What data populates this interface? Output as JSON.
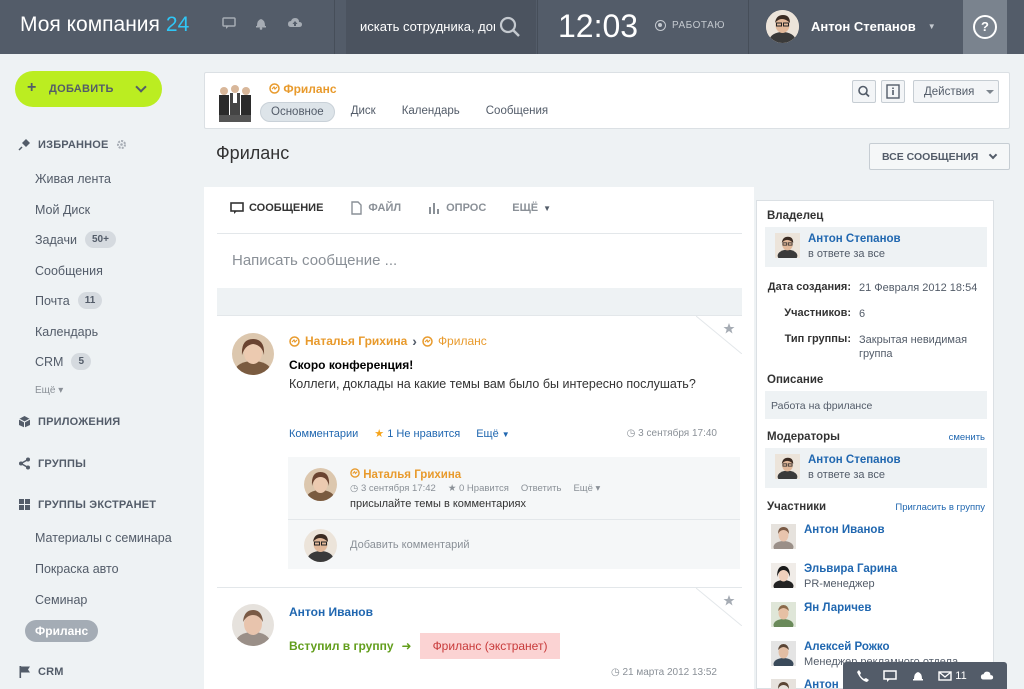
{
  "header": {
    "logo_text": "Моя компания",
    "logo_num": "24",
    "search_placeholder": "искать сотрудника, док",
    "clock": "12:03",
    "status": "РАБОТАЮ",
    "user_name": "Антон Степанов",
    "help": "?"
  },
  "sidebar": {
    "add_label": "ДОБАВИТЬ",
    "favorites": "ИЗБРАННОЕ",
    "items": [
      {
        "label": "Живая лента",
        "badge": ""
      },
      {
        "label": "Мой Диск",
        "badge": ""
      },
      {
        "label": "Задачи",
        "badge": "50+"
      },
      {
        "label": "Сообщения",
        "badge": ""
      },
      {
        "label": "Почта",
        "badge": "11"
      },
      {
        "label": "Календарь",
        "badge": ""
      },
      {
        "label": "CRM",
        "badge": "5"
      }
    ],
    "more": "Ещё",
    "apps": "ПРИЛОЖЕНИЯ",
    "groups": "ГРУППЫ",
    "extranet": "ГРУППЫ ЭКСТРАНЕТ",
    "extranet_items": [
      "Материалы с семинара",
      "Покраска авто",
      "Семинар"
    ],
    "active_item": "Фриланс",
    "crm": "CRM"
  },
  "group": {
    "name": "Фриланс",
    "tabs": [
      "Основное",
      "Диск",
      "Календарь",
      "Сообщения"
    ],
    "actions": "Действия",
    "page_title": "Фриланс",
    "filter": "ВСЕ СООБЩЕНИЯ"
  },
  "composer": {
    "tabs": [
      "СООБЩЕНИЕ",
      "ФАЙЛ",
      "ОПРОС",
      "ЕЩЁ"
    ],
    "placeholder": "Написать сообщение ..."
  },
  "posts": [
    {
      "author": "Наталья Грихина",
      "group": "Фриланс",
      "title": "Скоро конференция!",
      "text": "Коллеги, доклады на какие темы вам было бы интересно послушать?",
      "comments_link": "Комментарии",
      "likes": "1",
      "dislike": "Не нравится",
      "more": "Ещё",
      "date": "3 сентября 17:40",
      "comment": {
        "author": "Наталья Грихина",
        "date": "3 сентября 17:42",
        "likes": "0",
        "like_label": "Нравится",
        "reply": "Ответить",
        "more": "Ещё",
        "text": "присылайте темы в комментариях"
      },
      "add_comment": "Добавить комментарий"
    },
    {
      "author": "Антон Иванов",
      "joined": "Вступил в группу",
      "group_tag": "Фриланс (экстранет)",
      "date": "21 марта 2012 13:52"
    }
  ],
  "panel": {
    "owner_h": "Владелец",
    "owner_name": "Антон Степанов",
    "owner_role": "в ответе за все",
    "created_k": "Дата создания:",
    "created_v": "21 Февраля 2012 18:54",
    "members_k": "Участников:",
    "members_v": "6",
    "type_k": "Тип группы:",
    "type_v": "Закрытая невидимая группа",
    "desc_h": "Описание",
    "desc_v": "Работа на фрилансе",
    "mods_h": "Модераторы",
    "mods_link": "сменить",
    "mod_name": "Антон Степанов",
    "mod_role": "в ответе за все",
    "members_h": "Участники",
    "invite_link": "Пригласить в группу",
    "members": [
      {
        "name": "Антон Иванов",
        "role": ""
      },
      {
        "name": "Эльвира Гарина",
        "role": "PR-менеджер"
      },
      {
        "name": "Ян Ларичев",
        "role": ""
      },
      {
        "name": "Алексей Рожко",
        "role": "Менеджер рекламного отдела"
      },
      {
        "name": "Антон",
        "role": ""
      }
    ]
  },
  "bottombar": {
    "mail_count": "11"
  }
}
